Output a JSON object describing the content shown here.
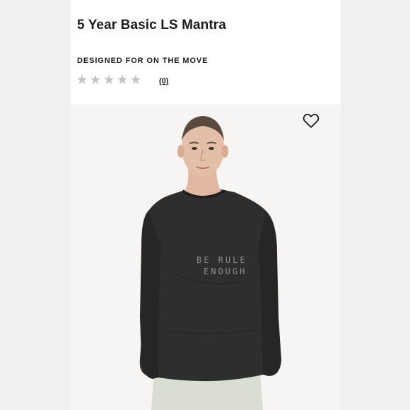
{
  "product": {
    "title": "5 Year Basic LS Mantra",
    "tagline": "DESIGNED FOR ON THE MOVE",
    "rating": 0,
    "max_rating": 5,
    "review_count": "(0)"
  },
  "image": {
    "print_text_line1": "BE RULE",
    "print_text_line2": "ENOUGH"
  },
  "icons": {
    "wishlist": "heart-outline-icon",
    "star": "star-icon"
  },
  "colors": {
    "background": "#f1f1f1",
    "card": "#ffffff",
    "star_empty": "#c4c4c4",
    "shirt": "#2d2e2d",
    "text": "#1b1b1b"
  }
}
